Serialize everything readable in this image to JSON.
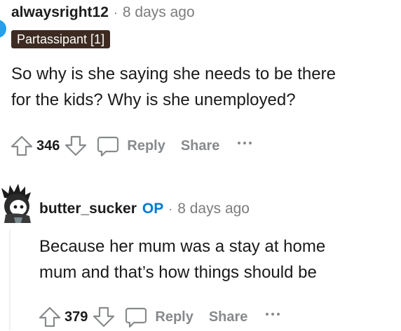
{
  "comment1": {
    "username": "alwaysright12",
    "separator": "·",
    "timestamp": "8 days ago",
    "flair": "Partassipant [1]",
    "body_line1": "So why is she saying she needs to be there",
    "body_line2": "for the kids? Why is she unemployed?",
    "score": "346",
    "reply_label": "Reply",
    "share_label": "Share"
  },
  "comment2": {
    "username": "butter_sucker",
    "op_badge": "OP",
    "separator": "·",
    "timestamp": "8 days ago",
    "body_line1": "Because her mum was a stay at home",
    "body_line2": "mum and that’s how things should be",
    "score": "379",
    "reply_label": "Reply",
    "share_label": "Share"
  },
  "icons": {
    "upvote": "upvote-icon",
    "downvote": "downvote-icon",
    "reply": "reply-icon",
    "more": "more-icon"
  },
  "colors": {
    "flair_bg": "#3d2b22",
    "op_blue": "#0079d3",
    "muted": "#878a8c",
    "avatar_blue": "#24a0ed"
  }
}
